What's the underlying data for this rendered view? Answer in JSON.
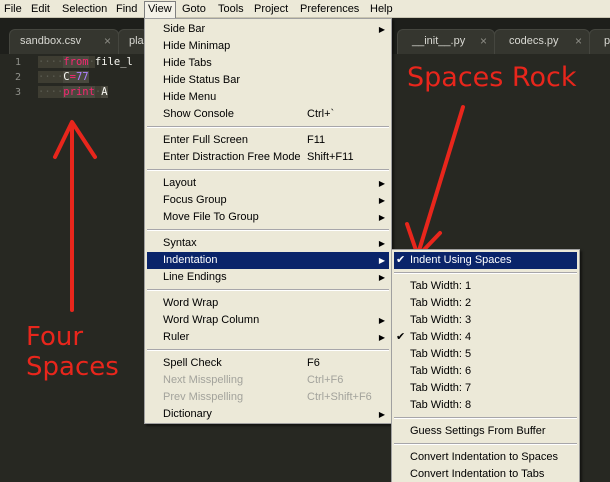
{
  "menubar": [
    "File",
    "Edit",
    "Selection",
    "Find",
    "View",
    "Goto",
    "Tools",
    "Project",
    "Preferences",
    "Help"
  ],
  "tabs": [
    {
      "label": "sandbox.csv",
      "close": "×"
    },
    {
      "label": "pla",
      "close": ""
    },
    {
      "label": "__init__.py",
      "close": "×"
    },
    {
      "label": "codecs.py",
      "close": "×"
    },
    {
      "label": "p",
      "close": ""
    }
  ],
  "editor": {
    "line_numbers": [
      "1",
      "2",
      "3"
    ],
    "lines": [
      {
        "ws": "····",
        "kw": "from",
        "ws2": "·",
        "plain": "file_l"
      },
      {
        "ws": "····",
        "var": "C",
        "op": "=",
        "num": "77"
      },
      {
        "ws": "····",
        "kw": "print",
        "ws2": "·",
        "plain": "A"
      }
    ]
  },
  "annotations": {
    "spaces_rock": "Spaces Rock",
    "four": "Four",
    "spaces": "Spaces",
    "color": "#e8261c"
  },
  "view_menu": [
    {
      "label": "Side Bar",
      "arrow": "▶"
    },
    {
      "label": "Hide Minimap"
    },
    {
      "label": "Hide Tabs"
    },
    {
      "label": "Hide Status Bar"
    },
    {
      "label": "Hide Menu"
    },
    {
      "label": "Show Console",
      "shortcut": "Ctrl+`"
    },
    {
      "label": "Enter Full Screen",
      "shortcut": "F11"
    },
    {
      "label": "Enter Distraction Free Mode",
      "shortcut": "Shift+F11"
    },
    {
      "label": "Layout",
      "arrow": "▶"
    },
    {
      "label": "Focus Group",
      "arrow": "▶"
    },
    {
      "label": "Move File To Group",
      "arrow": "▶"
    },
    {
      "label": "Syntax",
      "arrow": "▶"
    },
    {
      "label": "Indentation",
      "arrow": "▶"
    },
    {
      "label": "Line Endings",
      "arrow": "▶"
    },
    {
      "label": "Word Wrap"
    },
    {
      "label": "Word Wrap Column",
      "arrow": "▶"
    },
    {
      "label": "Ruler",
      "arrow": "▶"
    },
    {
      "label": "Spell Check",
      "shortcut": "F6"
    },
    {
      "label": "Next Misspelling",
      "shortcut": "Ctrl+F6"
    },
    {
      "label": "Prev Misspelling",
      "shortcut": "Ctrl+Shift+F6"
    },
    {
      "label": "Dictionary",
      "arrow": "▶"
    }
  ],
  "indentation_menu": [
    {
      "label": "Indent Using Spaces",
      "check": "✔"
    },
    {
      "label": "Tab Width: 1"
    },
    {
      "label": "Tab Width: 2"
    },
    {
      "label": "Tab Width: 3"
    },
    {
      "label": "Tab Width: 4",
      "check": "✔"
    },
    {
      "label": "Tab Width: 5"
    },
    {
      "label": "Tab Width: 6"
    },
    {
      "label": "Tab Width: 7"
    },
    {
      "label": "Tab Width: 8"
    },
    {
      "label": "Guess Settings From Buffer"
    },
    {
      "label": "Convert Indentation to Spaces"
    },
    {
      "label": "Convert Indentation to Tabs"
    }
  ]
}
